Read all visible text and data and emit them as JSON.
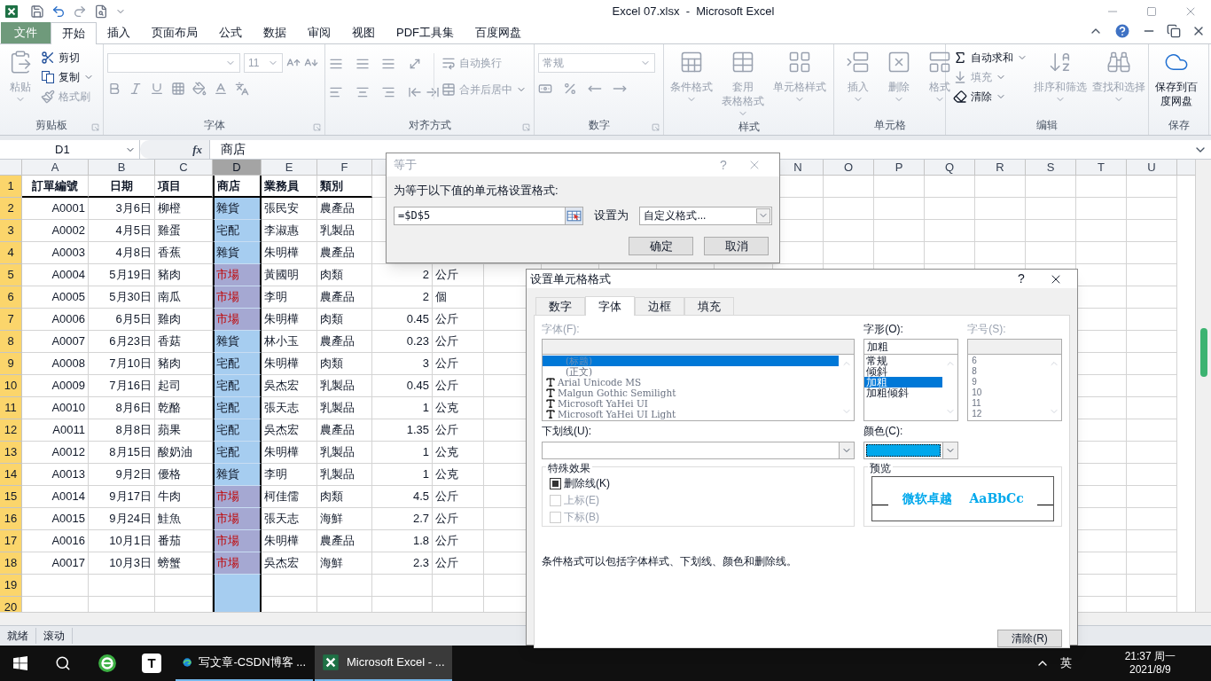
{
  "window": {
    "title": "Excel 07.xlsx  -  Microsoft Excel"
  },
  "ribbon_tabs": [
    {
      "label": "文件",
      "kind": "file",
      "selected": false
    },
    {
      "label": "开始",
      "kind": "tab",
      "selected": true
    },
    {
      "label": "插入",
      "kind": "tab",
      "selected": false
    },
    {
      "label": "页面布局",
      "kind": "tab",
      "selected": false
    },
    {
      "label": "公式",
      "kind": "tab",
      "selected": false
    },
    {
      "label": "数据",
      "kind": "tab",
      "selected": false
    },
    {
      "label": "审阅",
      "kind": "tab",
      "selected": false
    },
    {
      "label": "视图",
      "kind": "tab",
      "selected": false
    },
    {
      "label": "PDF工具集",
      "kind": "tab",
      "selected": false
    },
    {
      "label": "百度网盘",
      "kind": "tab",
      "selected": false
    }
  ],
  "ribbon": {
    "clipboard": {
      "label": "剪贴板",
      "large": {
        "label": "粘贴",
        "disabled": true
      },
      "small": [
        {
          "label": "剪切",
          "disabled": false
        },
        {
          "label": "复制",
          "disabled": false
        },
        {
          "label": "格式刷",
          "disabled": true
        }
      ]
    },
    "font": {
      "label": "字体",
      "size": "11"
    },
    "alignment": {
      "label": "对齐方式",
      "small": [
        {
          "label": "自动换行",
          "disabled": true
        },
        {
          "label": "合并后居中",
          "disabled": true
        }
      ]
    },
    "number": {
      "label": "数字",
      "format": "常规"
    },
    "styles": {
      "label": "样式",
      "large": [
        {
          "label": "条件格式",
          "disabled": true
        },
        {
          "lines": [
            "套用",
            "表格格式"
          ],
          "disabled": true
        },
        {
          "label": "单元格样式",
          "disabled": true
        }
      ]
    },
    "cells": {
      "label": "单元格",
      "large": [
        {
          "label": "插入",
          "disabled": true
        },
        {
          "label": "删除",
          "disabled": true
        },
        {
          "label": "格式",
          "disabled": true
        }
      ]
    },
    "editing": {
      "label": "编辑",
      "small": [
        {
          "label": "自动求和",
          "disabled": false
        },
        {
          "label": "填充",
          "disabled": true
        },
        {
          "label": "清除",
          "disabled": false
        }
      ],
      "large": [
        {
          "label": "排序和筛选",
          "disabled": true
        },
        {
          "label": "查找和选择",
          "disabled": true
        }
      ]
    },
    "save": {
      "label": "保存",
      "large": [
        {
          "lines": [
            "保存到百",
            "度网盘"
          ],
          "disabled": false
        }
      ]
    }
  },
  "formula_bar": {
    "name_box": "D1",
    "function_glyph": "fx",
    "formula": "商店"
  },
  "sheet": {
    "columns_left": [
      {
        "letter": "A",
        "selected": false
      },
      {
        "letter": "B",
        "selected": false
      },
      {
        "letter": "C",
        "selected": false
      },
      {
        "letter": "D",
        "selected": true
      },
      {
        "letter": "E",
        "selected": false
      },
      {
        "letter": "F",
        "selected": false
      }
    ],
    "columns_right": [
      "N",
      "O",
      "P",
      "Q",
      "R",
      "S",
      "T",
      "U"
    ],
    "header_row": {
      "number": "1",
      "cells": [
        "訂單編號",
        "日期",
        "項目",
        "商店",
        "業務員",
        "類別"
      ]
    },
    "rows": [
      {
        "number": "2",
        "id": "A0001",
        "date": "3月6日",
        "item": "柳橙",
        "store": "雜貨",
        "flagged": false,
        "staff": "張民安",
        "category": "農產品"
      },
      {
        "number": "3",
        "id": "A0002",
        "date": "4月5日",
        "item": "雞蛋",
        "store": "宅配",
        "flagged": false,
        "staff": "李淑惠",
        "category": "乳製品"
      },
      {
        "number": "4",
        "id": "A0003",
        "date": "4月8日",
        "item": "香蕉",
        "store": "雜貨",
        "flagged": false,
        "staff": "朱明樺",
        "category": "農產品"
      },
      {
        "number": "5",
        "id": "A0004",
        "date": "5月19日",
        "item": "豬肉",
        "store": "市場",
        "flagged": true,
        "staff": "黃國明",
        "category": "肉類",
        "qty": "2",
        "unit": "公斤"
      },
      {
        "number": "6",
        "id": "A0005",
        "date": "5月30日",
        "item": "南瓜",
        "store": "市場",
        "flagged": true,
        "staff": "李明",
        "category": "農產品",
        "qty": "2",
        "unit": "個"
      },
      {
        "number": "7",
        "id": "A0006",
        "date": "6月5日",
        "item": "雞肉",
        "store": "市場",
        "flagged": true,
        "staff": "朱明樺",
        "category": "肉類",
        "qty": "0.45",
        "unit": "公斤"
      },
      {
        "number": "8",
        "id": "A0007",
        "date": "6月23日",
        "item": "香菇",
        "store": "雜貨",
        "flagged": false,
        "staff": "林小玉",
        "category": "農產品",
        "qty": "0.23",
        "unit": "公斤"
      },
      {
        "number": "9",
        "id": "A0008",
        "date": "7月10日",
        "item": "豬肉",
        "store": "宅配",
        "flagged": false,
        "staff": "朱明樺",
        "category": "肉類",
        "qty": "3",
        "unit": "公斤"
      },
      {
        "number": "10",
        "id": "A0009",
        "date": "7月16日",
        "item": "起司",
        "store": "宅配",
        "flagged": false,
        "staff": "吳杰宏",
        "category": "乳製品",
        "qty": "0.45",
        "unit": "公斤"
      },
      {
        "number": "11",
        "id": "A0010",
        "date": "8月6日",
        "item": "乾酪",
        "store": "宅配",
        "flagged": false,
        "staff": "張天志",
        "category": "乳製品",
        "qty": "1",
        "unit": "公克"
      },
      {
        "number": "12",
        "id": "A0011",
        "date": "8月8日",
        "item": "蘋果",
        "store": "宅配",
        "flagged": false,
        "staff": "吳杰宏",
        "category": "農產品",
        "qty": "1.35",
        "unit": "公斤"
      },
      {
        "number": "13",
        "id": "A0012",
        "date": "8月15日",
        "item": "酸奶油",
        "store": "宅配",
        "flagged": false,
        "staff": "朱明樺",
        "category": "乳製品",
        "qty": "1",
        "unit": "公克"
      },
      {
        "number": "14",
        "id": "A0013",
        "date": "9月2日",
        "item": "優格",
        "store": "雜貨",
        "flagged": false,
        "staff": "李明",
        "category": "乳製品",
        "qty": "1",
        "unit": "公克"
      },
      {
        "number": "15",
        "id": "A0014",
        "date": "9月17日",
        "item": "牛肉",
        "store": "市場",
        "flagged": true,
        "staff": "柯佳儒",
        "category": "肉類",
        "qty": "4.5",
        "unit": "公斤"
      },
      {
        "number": "16",
        "id": "A0015",
        "date": "9月24日",
        "item": "鮭魚",
        "store": "市場",
        "flagged": true,
        "staff": "張天志",
        "category": "海鮮",
        "qty": "2.7",
        "unit": "公斤"
      },
      {
        "number": "17",
        "id": "A0016",
        "date": "10月1日",
        "item": "番茄",
        "store": "市場",
        "flagged": true,
        "staff": "朱明樺",
        "category": "農產品",
        "qty": "1.8",
        "unit": "公斤"
      },
      {
        "number": "18",
        "id": "A0017",
        "date": "10月3日",
        "item": "螃蟹",
        "store": "市場",
        "flagged": true,
        "staff": "吳杰宏",
        "category": "海鮮",
        "qty": "2.3",
        "unit": "公斤"
      },
      {
        "number": "19"
      },
      {
        "number": "20"
      }
    ]
  },
  "equals_dialog": {
    "title": "等于",
    "help_glyph": "?",
    "prompt": "为等于以下值的单元格设置格式:",
    "value": "=$D$5",
    "format_label": "设置为",
    "format_value": "自定义格式...",
    "buttons": [
      "确定",
      "取消"
    ]
  },
  "format_dialog": {
    "title": "设置单元格格式",
    "help_glyph": "?",
    "tabs": [
      {
        "label": "数字",
        "selected": false
      },
      {
        "label": "字体",
        "selected": true
      },
      {
        "label": "边框",
        "selected": false
      },
      {
        "label": "填充",
        "selected": false
      }
    ],
    "font": {
      "label": "字体(F):",
      "items": [
        {
          "label": "(标题)",
          "kind": "theme",
          "selected": true
        },
        {
          "label": "(正文)",
          "kind": "theme",
          "selected": false
        },
        {
          "label": "Arial Unicode MS",
          "kind": "truetype",
          "selected": false
        },
        {
          "label": "Malgun Gothic Semilight",
          "kind": "truetype",
          "selected": false
        },
        {
          "label": "Microsoft YaHei UI",
          "kind": "truetype",
          "selected": false
        },
        {
          "label": "Microsoft YaHei UI Light",
          "kind": "truetype",
          "selected": false
        }
      ]
    },
    "style": {
      "label": "字形(O):",
      "value": "加粗",
      "items": [
        {
          "label": "常规",
          "selected": false
        },
        {
          "label": "倾斜",
          "selected": false
        },
        {
          "label": "加粗",
          "selected": true
        },
        {
          "label": "加粗倾斜",
          "selected": false
        }
      ]
    },
    "size": {
      "label": "字号(S):",
      "items": [
        "6",
        "8",
        "9",
        "10",
        "11",
        "12"
      ]
    },
    "underline": {
      "label": "下划线(U):"
    },
    "color": {
      "label": "颜色(C):",
      "color": "#00a8ec"
    },
    "effects": {
      "label": "特殊效果",
      "items": [
        {
          "label": "删除线(K)",
          "indeterminate": true,
          "disabled": false
        },
        {
          "label": "上标(E)",
          "indeterminate": false,
          "disabled": true
        },
        {
          "label": "下标(B)",
          "indeterminate": false,
          "disabled": true
        }
      ]
    },
    "preview": {
      "label": "预览",
      "samples": [
        "微软卓越",
        "AaBbCc"
      ]
    },
    "note": "条件格式可以包括字体样式、下划线、颜色和删除线。",
    "clear_button": "清除(R)"
  },
  "status_bar": [
    "就绪",
    "滚动"
  ],
  "taskbar": {
    "letter_app_glyph": "T",
    "apps": [
      {
        "label": "写文章-CSDN博客 ...",
        "kind": "browser",
        "selected": false
      },
      {
        "label": "Microsoft Excel - ...",
        "kind": "excel",
        "selected": true
      }
    ],
    "ime": "英",
    "time": "21:37 周一",
    "date": "2021/8/9"
  }
}
